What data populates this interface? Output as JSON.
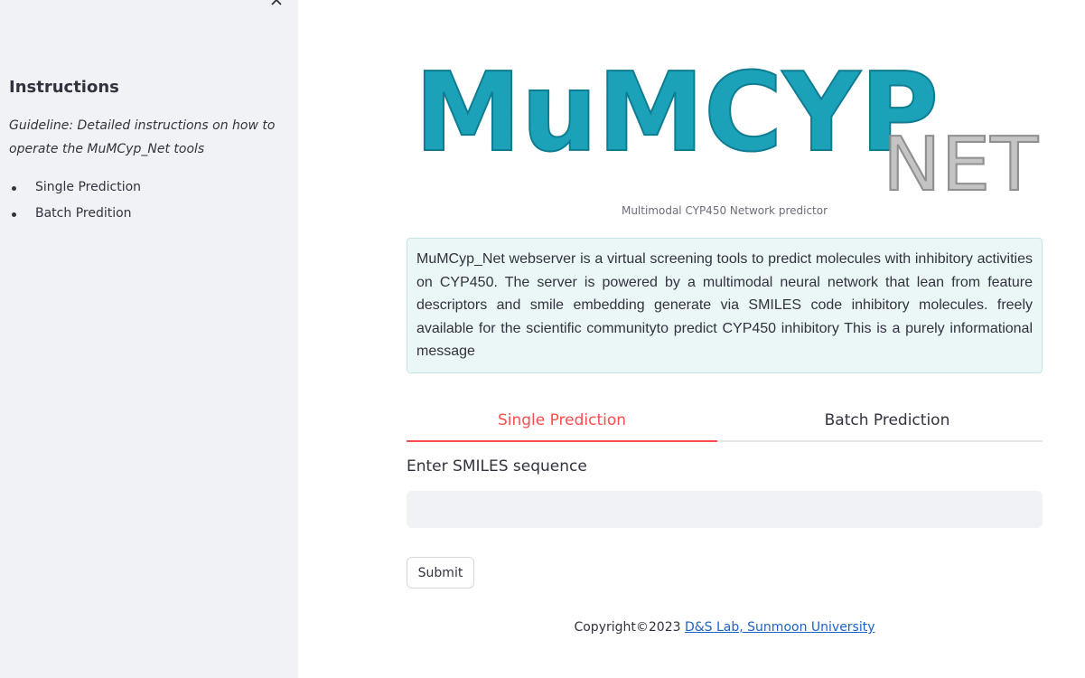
{
  "sidebar": {
    "close_icon": "close-icon",
    "title": "Instructions",
    "guideline": "Guideline: Detailed instructions on how to operate the MuMCyp_Net tools",
    "items": [
      {
        "label": "Single Prediction"
      },
      {
        "label": "Batch Predition"
      }
    ]
  },
  "logo": {
    "main_text": "MuMCYP",
    "sub_text": "NET",
    "colors": {
      "main": "#1ba2b8",
      "sub": "#b8b8b8"
    }
  },
  "main": {
    "caption": "Multimodal CYP450 Network predictor",
    "info_message": "MuMCyp_Net webserver is a virtual screening tools to predict molecules with inhibitory activities on CYP450. The server is powered by a multimodal neural network that lean from feature descriptors and smile embedding generate via SMILES code inhibitory molecules. freely available for the scientific communityto predict CYP450 inhibitory This is a purely informational message",
    "tabs": [
      {
        "label": "Single Prediction",
        "active": true
      },
      {
        "label": "Batch Prediction",
        "active": false
      }
    ],
    "input_label": "Enter SMILES sequence",
    "input_value": "",
    "input_placeholder": "",
    "submit_label": "Submit"
  },
  "footer": {
    "copyright": "Copyright©2023 ",
    "link_text": "D&S Lab, Sunmoon University"
  },
  "colors": {
    "accent": "#ff4b4b",
    "sidebar_bg": "#f0f2f6",
    "info_bg": "#ebf6f6",
    "link": "#1c63c7"
  }
}
